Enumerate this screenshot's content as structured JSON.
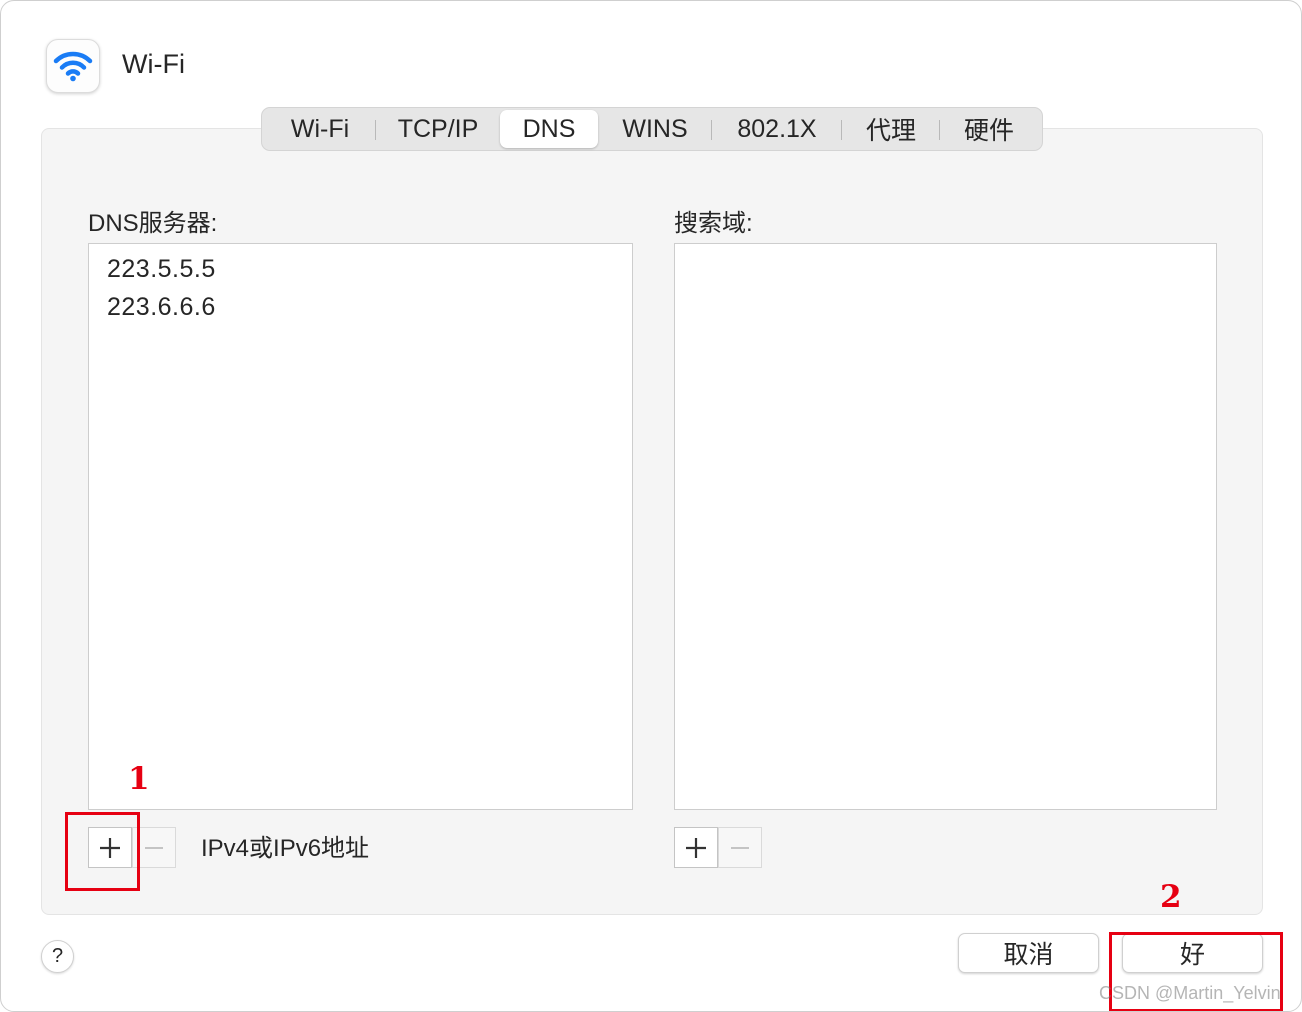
{
  "window": {
    "title": "Wi-Fi",
    "app_icon": "wifi-icon",
    "wifi_color": "#1a7cf5"
  },
  "tabs": [
    {
      "label": "Wi-Fi",
      "active": false
    },
    {
      "label": "TCP/IP",
      "active": false
    },
    {
      "label": "DNS",
      "active": true
    },
    {
      "label": "WINS",
      "active": false
    },
    {
      "label": "802.1X",
      "active": false
    },
    {
      "label": "代理",
      "active": false
    },
    {
      "label": "硬件",
      "active": false
    }
  ],
  "dns": {
    "label": "DNS服务器:",
    "servers": [
      "223.5.5.5",
      "223.6.6.6"
    ],
    "add_symbol": "+",
    "remove_symbol": "−",
    "hint": "IPv4或IPv6地址"
  },
  "search": {
    "label": "搜索域:",
    "domains": [],
    "add_symbol": "+",
    "remove_symbol": "−"
  },
  "footer": {
    "help": "?",
    "cancel": "取消",
    "ok": "好"
  },
  "annotations": {
    "marker1": "1",
    "marker2": "2",
    "color": "#e60012"
  },
  "watermark": "CSDN @Martin_Yelvin"
}
